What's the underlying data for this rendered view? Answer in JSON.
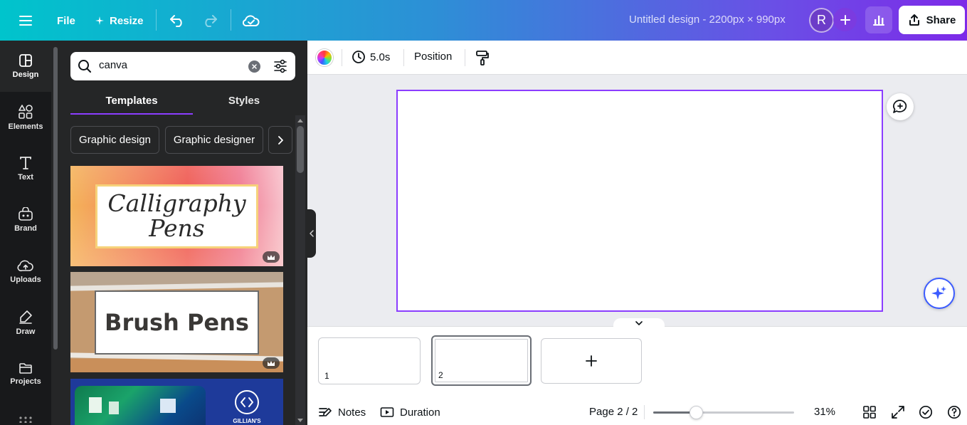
{
  "topbar": {
    "menu_icon": "hamburger-icon",
    "file_label": "File",
    "resize_label": "Resize",
    "doc_title": "Untitled design - 2200px × 990px",
    "avatar_initial": "R",
    "share_label": "Share"
  },
  "rail": {
    "items": [
      {
        "label": "Design",
        "icon": "design-icon"
      },
      {
        "label": "Elements",
        "icon": "elements-icon"
      },
      {
        "label": "Text",
        "icon": "text-icon"
      },
      {
        "label": "Brand",
        "icon": "brand-icon"
      },
      {
        "label": "Uploads",
        "icon": "upload-icon"
      },
      {
        "label": "Draw",
        "icon": "draw-icon"
      },
      {
        "label": "Projects",
        "icon": "folder-icon"
      }
    ]
  },
  "panel": {
    "search_value": "canva",
    "tabs": [
      {
        "label": "Templates"
      },
      {
        "label": "Styles"
      }
    ],
    "chips": [
      {
        "label": "Graphic design"
      },
      {
        "label": "Graphic designer"
      }
    ],
    "templates": [
      {
        "line1": "Calligraphy",
        "line2": "Pens"
      },
      {
        "line1": "Brush Pens"
      },
      {
        "brand": "GILLIAN'S"
      }
    ]
  },
  "toolbar": {
    "duration": "5.0s",
    "position_label": "Position"
  },
  "pages": {
    "thumbs": [
      {
        "num": "1"
      },
      {
        "num": "2"
      }
    ]
  },
  "footer": {
    "notes_label": "Notes",
    "duration_label": "Duration",
    "page_indicator": "Page 2 / 2",
    "zoom": "31%",
    "zoom_fraction": 0.31
  },
  "colors": {
    "accent": "#8b3dff",
    "rail_bg": "#18191b",
    "panel_bg": "#252627"
  }
}
